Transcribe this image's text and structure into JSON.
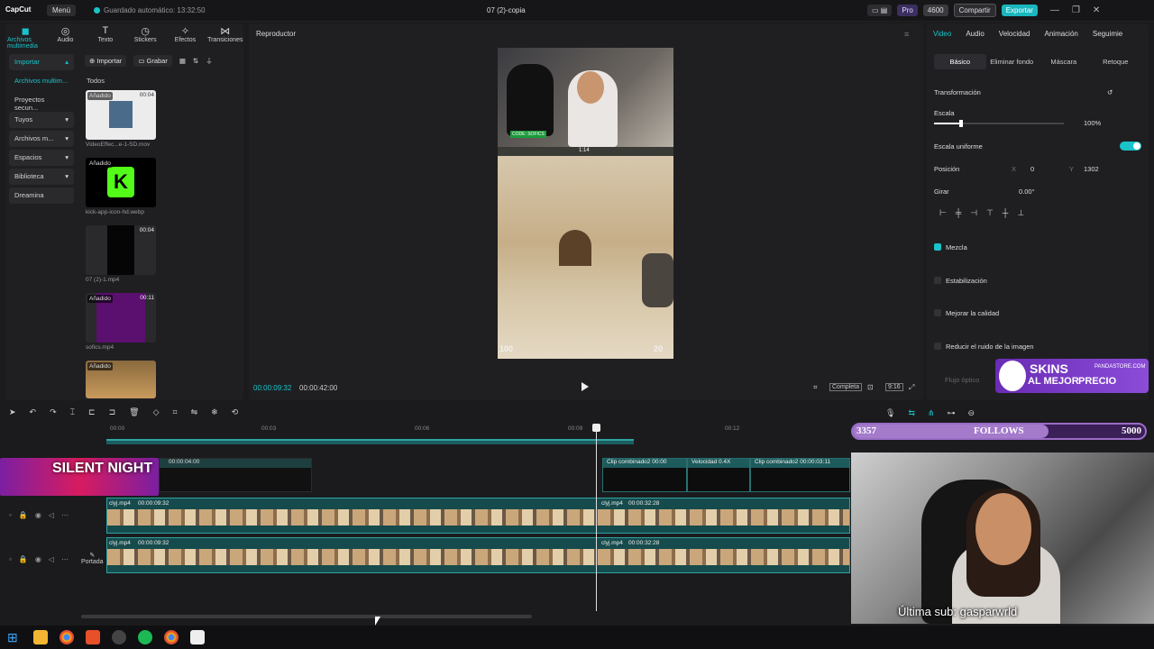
{
  "titlebar": {
    "app": "CapCut",
    "menu": "Menú",
    "autosave": "Guardado automático: 13:32:50",
    "title": "07 (2)-copia",
    "pro": "Pro",
    "coins": "4600",
    "share": "Compartir",
    "export": "Exportar"
  },
  "media_tabs": [
    {
      "label": "Archivos multimedia",
      "icon": "media-icon"
    },
    {
      "label": "Audio",
      "icon": "audio-icon"
    },
    {
      "label": "Texto",
      "icon": "text-icon"
    },
    {
      "label": "Stickers",
      "icon": "sticker-icon"
    },
    {
      "label": "Efectos",
      "icon": "effects-icon"
    },
    {
      "label": "Transiciones",
      "icon": "transitions-icon"
    }
  ],
  "sidenav": [
    "Importar",
    "Archivos multim...",
    "Proyectos secun...",
    "Tuyos",
    "Archivos m...",
    "Espacios",
    "Biblioteca",
    "Dreamina"
  ],
  "media_toolbar": {
    "import": "Importar",
    "record": "Grabar"
  },
  "media_filter": "Todos",
  "media_items": [
    {
      "tag": "Añadido",
      "dur": "00:04",
      "name": "VideoEffec...e-1-SD.mov"
    },
    {
      "tag": "Añadido",
      "dur": "",
      "name": "kick-app-icon-hd.webp"
    },
    {
      "tag": "",
      "dur": "00:04",
      "name": "07 (2)-1.mp4"
    },
    {
      "tag": "Añadido",
      "dur": "00:11",
      "name": "sofics.mp4"
    },
    {
      "tag": "Añadido",
      "dur": "",
      "name": ""
    }
  ],
  "player": {
    "title": "Reproductor",
    "time": "00:00:09:32",
    "duration": "00:00:42:00",
    "mode": "Completa",
    "ratio": "9:16",
    "hud_left": "100",
    "hud_right": "20",
    "code_badge": "CODE: SOFICS",
    "timer": "1:14"
  },
  "right_tabs": [
    "Video",
    "Audio",
    "Velocidad",
    "Animación",
    "Seguimie"
  ],
  "sub_tabs": [
    "Básico",
    "Eliminar fondo",
    "Máscara",
    "Retoque"
  ],
  "props": {
    "transform": "Transformación",
    "scale_label": "Escala",
    "scale_value": "100%",
    "scale_level": 0.2,
    "uniform_scale": "Escala uniforme",
    "position_label": "Posición",
    "x_label": "X",
    "x_value": "0",
    "y_label": "Y",
    "y_value": "1302",
    "rotate_label": "Girar",
    "rotate_value": "0.00°",
    "blend": "Mezcla",
    "stabilize": "Estabilización",
    "enhance": "Mejorar la calidad",
    "denoise": "Reducir el ruido de la imagen",
    "optical_flow": "Flujo óptico"
  },
  "ruler": [
    "00:00",
    "00:03",
    "00:06",
    "00:09",
    "00:12"
  ],
  "clips": {
    "overlay": "00:00:04:00",
    "combined1": "Clip combinado2  00:00",
    "speed": "Velocidad 0.4X",
    "combined2": "Clip combinado2  00:00:03:11",
    "v1_name": "clyj.mp4",
    "v1_time": "00:00:09:32",
    "v1b_name": "clyj.mp4",
    "v1b_time": "00:00:32:28",
    "cover": "Portada"
  },
  "overlay_stream": {
    "banner": "SILENT NIGHT",
    "follows_current": "3357",
    "follows_label": "FOLLOWS",
    "follows_goal": "5000",
    "follows_progress": 0.67,
    "last_sub": "Última sub: gasparwrld",
    "ad_line1": "SKINS",
    "ad_line2": "AL MEJOR",
    "ad_line3": "PRECIO",
    "ad_site": "PANDASTORE.COM"
  }
}
